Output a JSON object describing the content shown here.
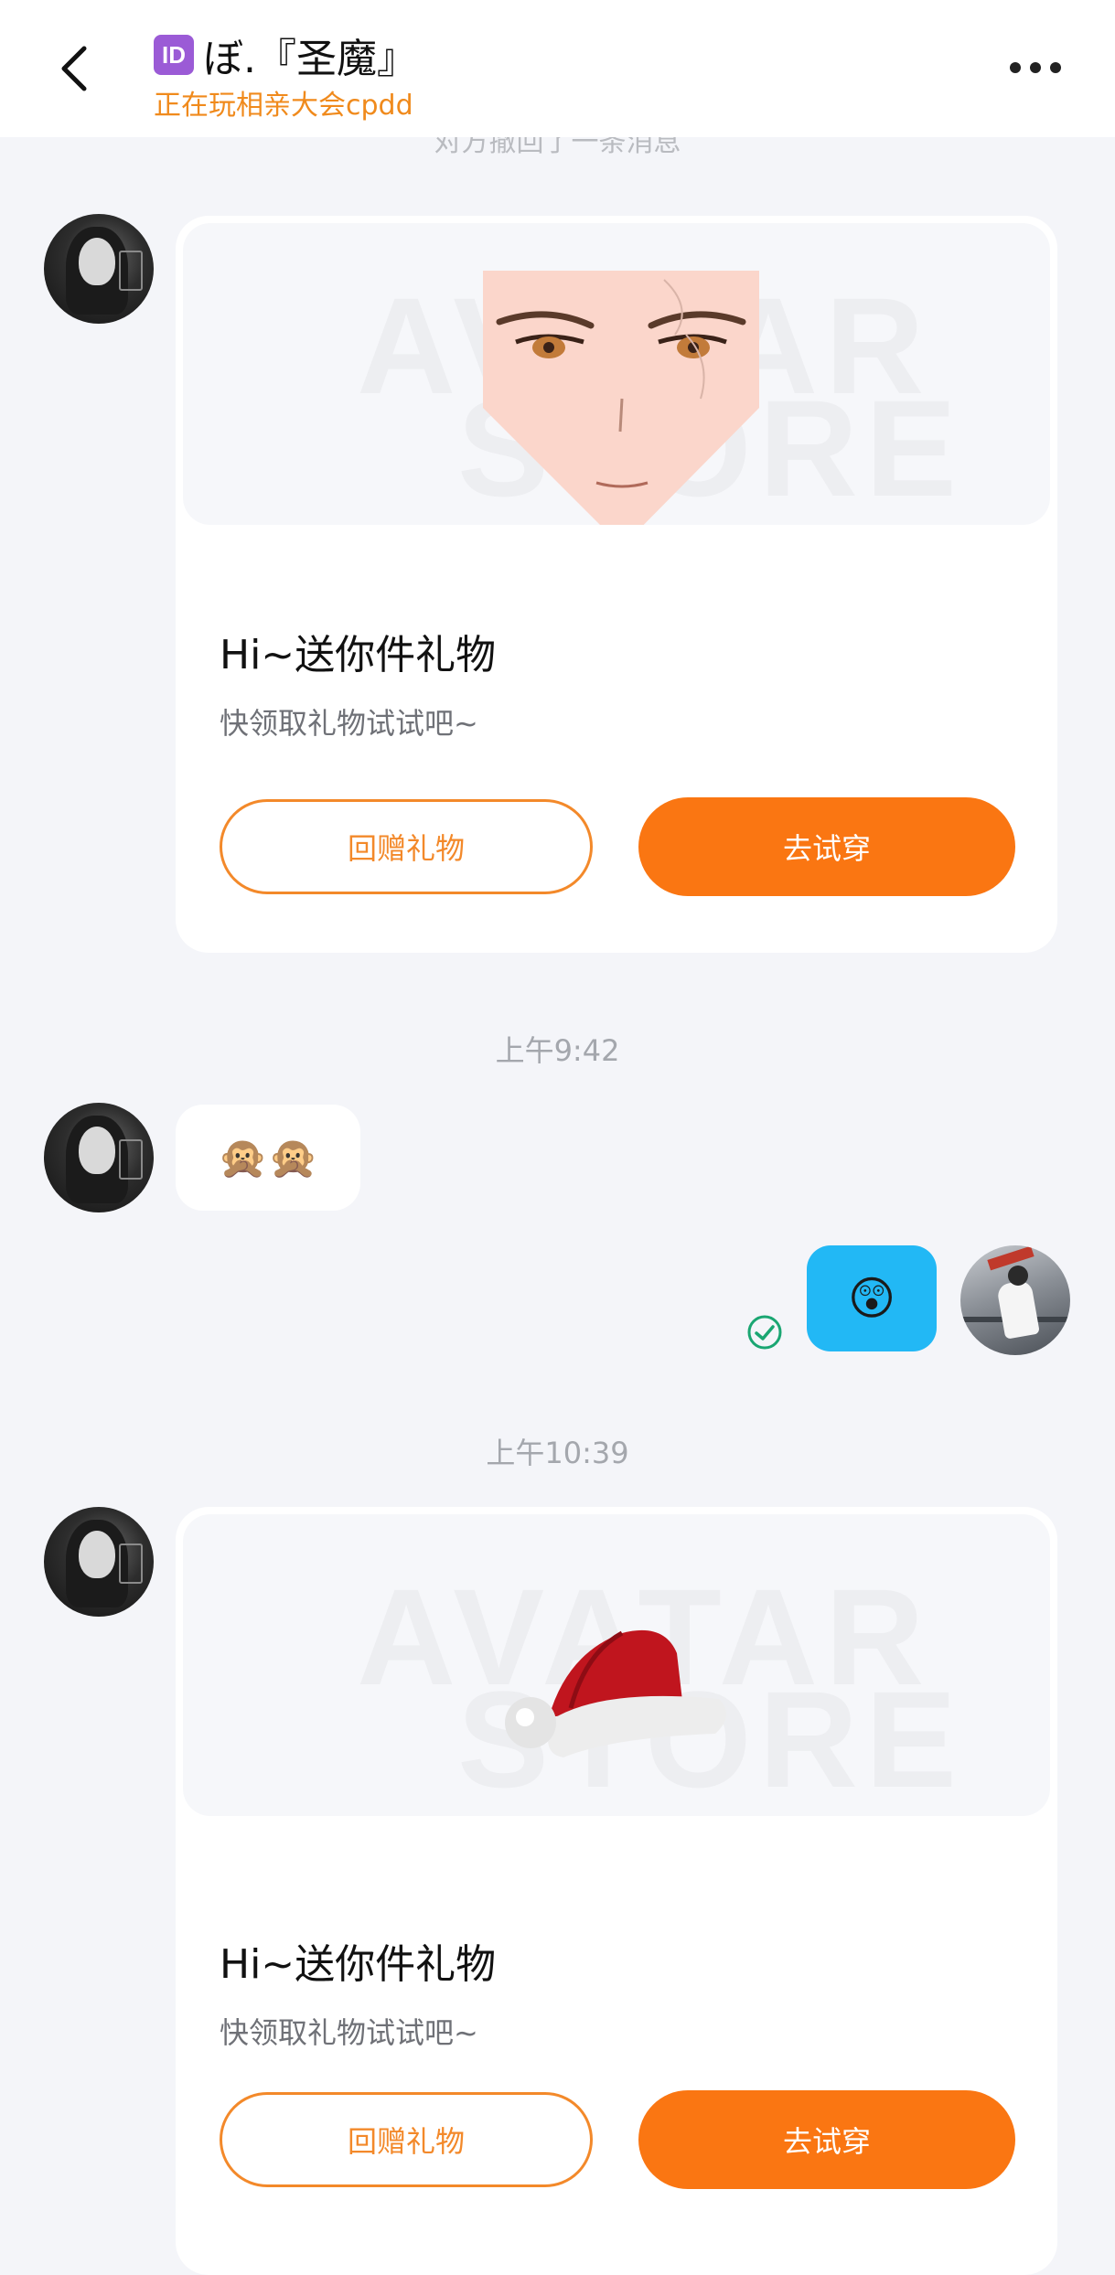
{
  "header": {
    "id_badge": "ID",
    "name": "ぼ.『圣魔』",
    "status": "正在玩相亲大会cpdd",
    "back_icon": "chevron-left-icon",
    "more_icon": "more-dots-icon"
  },
  "faded_notice": "对方撤回了一条消息",
  "messages": {
    "gift_card_1": {
      "image": "face-avatar-item",
      "watermark_top": "AVATAR",
      "watermark_bottom": "STORE",
      "title": "Hi~送你件礼物",
      "desc": "快领取礼物试试吧~",
      "btn_return": "回赠礼物",
      "btn_try": "去试穿"
    },
    "time_1": "上午9:42",
    "emoji_left": "🙊🙊",
    "emoji_right": "😲",
    "time_2": "上午10:39",
    "gift_card_2": {
      "image": "santa-hat-item",
      "watermark_top": "AVATAR",
      "watermark_bottom": "STORE",
      "title": "Hi~送你件礼物",
      "desc": "快领取礼物试试吧~",
      "btn_return": "回赠礼物",
      "btn_try": "去试穿"
    }
  },
  "colors": {
    "accent_orange": "#fa7612",
    "subtitle_orange": "#f08a1c",
    "bubble_blue": "#22b8f5",
    "read_green": "#1aa672",
    "page_bg": "#f4f5f9"
  }
}
